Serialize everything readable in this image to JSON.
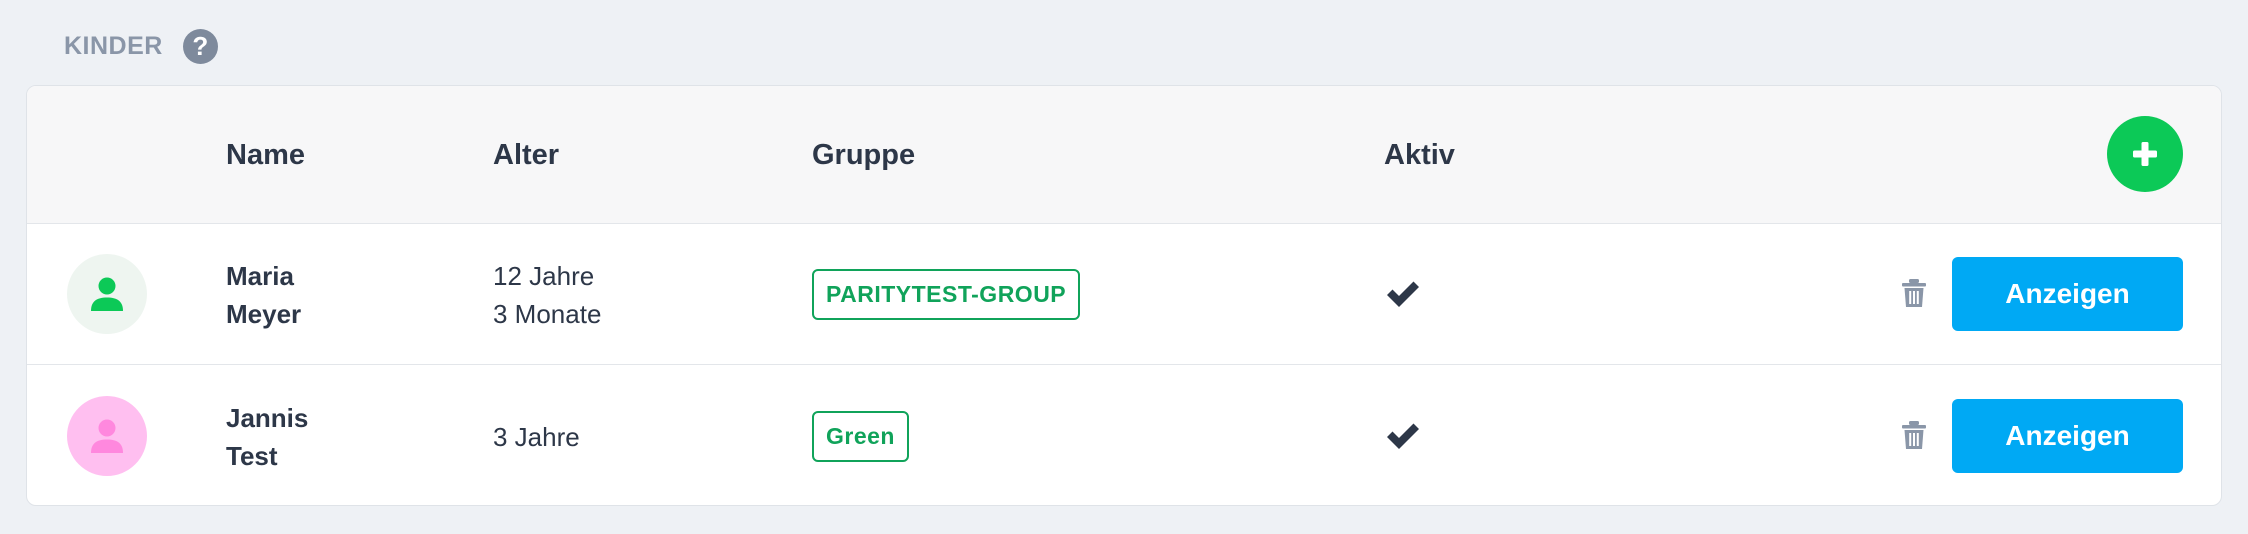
{
  "section": {
    "title": "KINDER",
    "help_icon": "question-circle-icon"
  },
  "table": {
    "columns": {
      "name": "Name",
      "alter": "Alter",
      "gruppe": "Gruppe",
      "aktiv": "Aktiv"
    },
    "add_icon": "plus-icon",
    "rows": [
      {
        "first_name": "Maria",
        "last_name": "Meyer",
        "age_line1": "12 Jahre",
        "age_line2": "3 Monate",
        "group": "PARITYTEST-GROUP",
        "active": true,
        "avatar_bg": "#eef5f0",
        "avatar_color": "#0cc957",
        "action_label": "Anzeigen"
      },
      {
        "first_name": "Jannis",
        "last_name": "Test",
        "age_line1": "3 Jahre",
        "age_line2": "",
        "group": "Green",
        "active": true,
        "avatar_bg": "#ffbff0",
        "avatar_color": "#ff88de",
        "action_label": "Anzeigen"
      }
    ]
  },
  "colors": {
    "accent_green": "#0cc957",
    "badge_green": "#10a35a",
    "button_blue": "#00a9f4",
    "check_dark": "#2d3748"
  }
}
